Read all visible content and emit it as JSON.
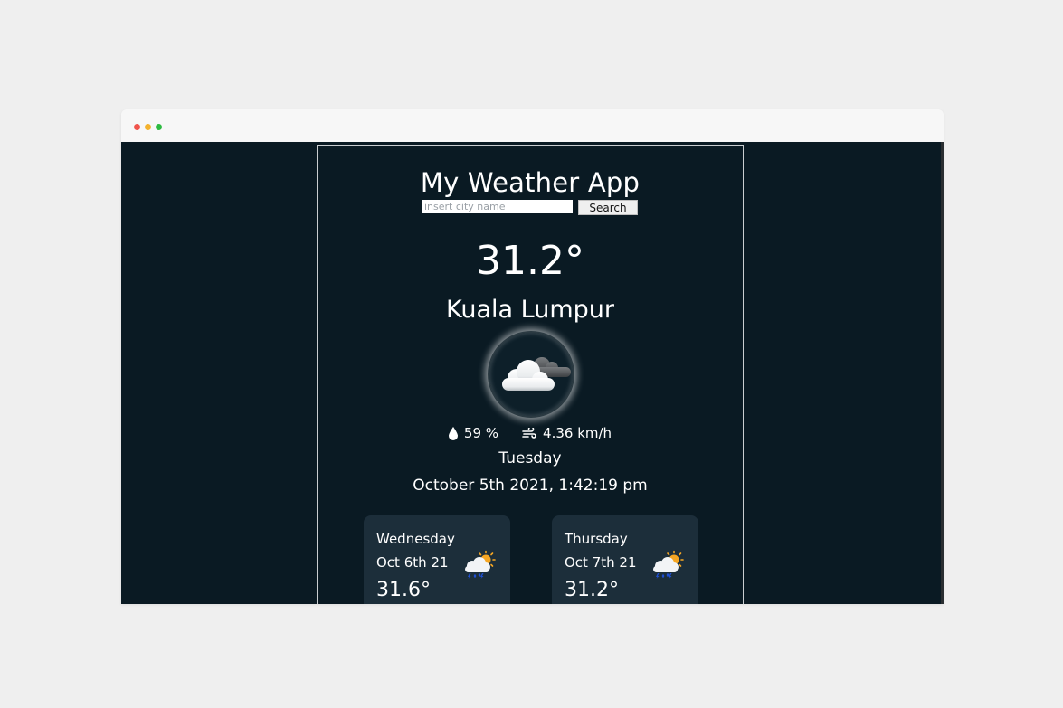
{
  "app": {
    "title": "My Weather App",
    "search": {
      "placeholder": "insert city name",
      "value": "",
      "button_label": "Search"
    }
  },
  "current": {
    "temperature": "31.2°",
    "city": "Kuala Lumpur",
    "icon": "cloudy-icon",
    "humidity": "59 %",
    "wind": "4.36 km/h",
    "day": "Tuesday",
    "datetime": "October 5th 2021, 1:42:19 pm"
  },
  "forecast": [
    {
      "day": "Wednesday",
      "date": "Oct 6th 21",
      "temperature": "31.6°",
      "icon": "thunderstorm-sun-icon"
    },
    {
      "day": "Thursday",
      "date": "Oct 7th 21",
      "temperature": "31.2°",
      "icon": "thunderstorm-sun-icon"
    }
  ],
  "colors": {
    "background": "#0a1a23",
    "card": "#1c2e3a",
    "text": "#ffffff",
    "page": "#efefef"
  }
}
